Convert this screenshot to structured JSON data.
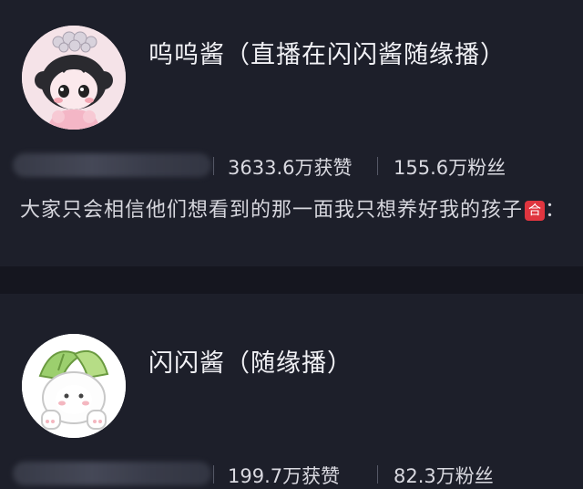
{
  "profiles": [
    {
      "name": "呜呜酱（直播在闪闪酱随缘播）",
      "likes": "3633.6万获赞",
      "fans": "155.6万粉丝",
      "bio": "大家只会相信他们想看到的那一面我只想养好我的孩子",
      "bio_tag": "合",
      "bio_suffix": "："
    },
    {
      "name": "闪闪酱（随缘播）",
      "likes": "199.7万获赞",
      "fans": "82.3万粉丝"
    }
  ],
  "colors": {
    "background": "#1d1f2a",
    "divider": "#15161f",
    "tag": "#e0353f"
  }
}
